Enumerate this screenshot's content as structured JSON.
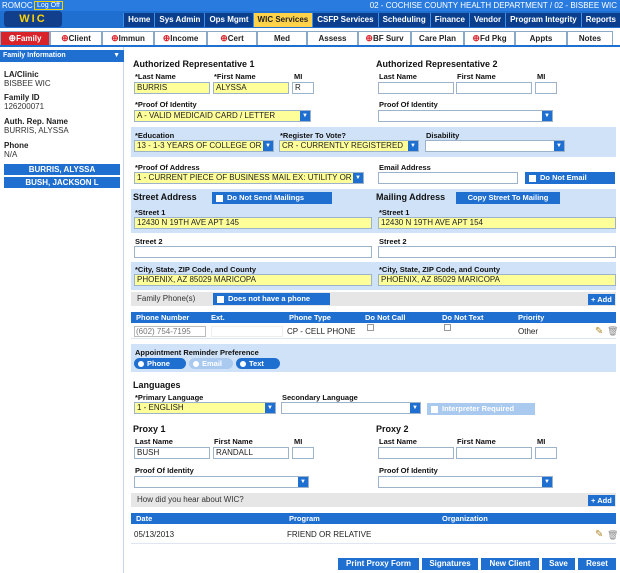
{
  "topbar": {
    "user": "ROMOC",
    "logoff": "Log Off",
    "logo_text": "WIC",
    "department": "02 - COCHISE COUNTY HEALTH DEPARTMENT / 02 - BISBEE WIC",
    "nav": [
      "Home",
      "Sys Admin",
      "Ops Mgmt",
      "WIC Services",
      "CSFP Services",
      "Scheduling",
      "Finance",
      "Vendor",
      "Program Integrity",
      "Reports"
    ],
    "active_nav": "WIC Services"
  },
  "subtabs": [
    {
      "label": "Family",
      "required": true,
      "active": true
    },
    {
      "label": "Client",
      "required": true
    },
    {
      "label": "Immun",
      "required": true
    },
    {
      "label": "Income",
      "required": true
    },
    {
      "label": "Cert",
      "required": true
    },
    {
      "label": "Med",
      "required": false
    },
    {
      "label": "Assess",
      "required": false
    },
    {
      "label": "BF Surv",
      "required": true
    },
    {
      "label": "Care Plan",
      "required": false
    },
    {
      "label": "Fd Pkg",
      "required": true
    },
    {
      "label": "Appts",
      "required": false
    },
    {
      "label": "Notes",
      "required": false
    }
  ],
  "sidebar": {
    "header": "Family Information",
    "laclinic_label": "LA/Clinic",
    "laclinic_value": "BISBEE WIC",
    "familyid_label": "Family ID",
    "familyid_value": "126200071",
    "authrep_label": "Auth. Rep. Name",
    "authrep_value": "BURRIS, ALYSSA",
    "phone_label": "Phone",
    "phone_value": "N/A",
    "members": [
      "BURRIS, ALYSSA",
      "BUSH, JACKSON L"
    ]
  },
  "authrep1": {
    "title": "Authorized Representative 1",
    "last_label": "*Last Name",
    "last_value": "BURRIS",
    "first_label": "*First Name",
    "first_value": "ALYSSA",
    "mi_label": "MI",
    "mi_value": "R",
    "poi_label": "*Proof Of Identity",
    "poi_value": "A - VALID MEDICAID CARD / LETTER"
  },
  "authrep2": {
    "title": "Authorized Representative 2",
    "last_label": "Last Name",
    "first_label": "First Name",
    "mi_label": "MI",
    "poi_label": "Proof Of Identity"
  },
  "education": {
    "label": "*Education",
    "value": "13 - 1-3 YEARS OF COLLEGE OR"
  },
  "vote": {
    "label": "*Register To Vote?",
    "value": "CR - CURRENTLY REGISTERED"
  },
  "disability": {
    "label": "Disability",
    "value": ""
  },
  "poa": {
    "label": "*Proof Of Address",
    "value": "1 - CURRENT PIECE OF BUSINESS MAIL EX: UTILITY OR"
  },
  "email": {
    "label": "Email Address",
    "value": "",
    "no_email": "Do Not Email"
  },
  "street": {
    "title": "Street Address",
    "no_mail": "Do Not Send Mailings",
    "s1_label": "*Street 1",
    "s1_value": "12430  N  19TH AVE APT 145",
    "s2_label": "Street 2",
    "s2_value": "",
    "csz_label": "*City, State, ZIP Code, and County",
    "csz_value": "PHOENIX, AZ 85029 MARICOPA"
  },
  "mailing": {
    "title": "Mailing Address",
    "copy": "Copy Street To Mailing",
    "s1_label": "*Street 1",
    "s1_value": "12430  N  19TH AVE APT 154",
    "s2_label": "Street 2",
    "s2_value": "",
    "csz_label": "*City, State, ZIP Code, and County",
    "csz_value": "PHOENIX, AZ 85029 MARICOPA"
  },
  "phones": {
    "title": "Family Phone(s)",
    "no_phone": "Does not have a phone",
    "add": "Add",
    "headers": [
      "Phone Number",
      "Ext.",
      "Phone Type",
      "Do Not Call",
      "Do Not Text",
      "Priority"
    ],
    "rows": [
      {
        "number": "(602) 754-7195",
        "ext": "",
        "type": "CP - CELL PHONE",
        "priority": "Other"
      }
    ]
  },
  "reminder": {
    "label": "Appointment Reminder Preference",
    "options": [
      "Phone",
      "Email",
      "Text"
    ]
  },
  "languages": {
    "title": "Languages",
    "primary_label": "*Primary Language",
    "primary_value": "1 - ENGLISH",
    "secondary_label": "Secondary Language",
    "secondary_value": "",
    "interp": "Interpreter Required"
  },
  "proxy1": {
    "title": "Proxy 1",
    "last_label": "Last Name",
    "last_value": "BUSH",
    "first_label": "First Name",
    "first_value": "RANDALL",
    "mi_label": "MI",
    "mi_value": "",
    "poi_label": "Proof Of Identity"
  },
  "proxy2": {
    "title": "Proxy 2",
    "last_label": "Last Name",
    "first_label": "First Name",
    "mi_label": "MI",
    "poi_label": "Proof Of Identity"
  },
  "heard": {
    "title": "How did you hear about WIC?",
    "add": "Add",
    "headers": [
      "Date",
      "Program",
      "Organization"
    ],
    "rows": [
      {
        "date": "05/13/2013",
        "program": "FRIEND OR RELATIVE",
        "organization": ""
      }
    ]
  },
  "bottom": [
    "Print Proxy Form",
    "Signatures",
    "New Client",
    "Save",
    "Reset"
  ],
  "colors": {
    "nav_blue": "#1f6fd1",
    "required_yellow": "#ffff9a",
    "active_tab": "#d8232a",
    "highlight_tab": "#ffd24a"
  }
}
